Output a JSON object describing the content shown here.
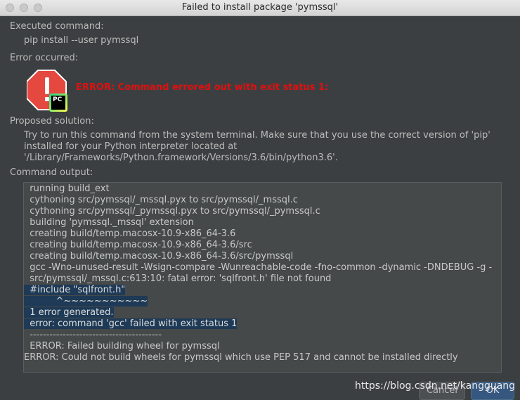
{
  "window": {
    "title": "Failed to install package 'pymssql'"
  },
  "executed": {
    "label": "Executed command:",
    "command": "pip install --user pymssql"
  },
  "error": {
    "label": "Error occurred:",
    "message": "ERROR: Command errored out with exit status 1:",
    "icon": "error-stop-icon",
    "badge": "PC"
  },
  "solution": {
    "label": "Proposed solution:",
    "lines": [
      "Try to run this command from the system terminal. Make sure that you use the correct version of 'pip'",
      "installed for your Python interpreter located at",
      "'/Library/Frameworks/Python.framework/Versions/3.6/bin/python3.6'."
    ]
  },
  "output": {
    "label": "Command output:",
    "lines": [
      "  running build_ext",
      "  cythoning src/pymssql/_mssql.pyx to src/pymssql/_mssql.c",
      "  cythoning src/pymssql/_pymssql.pyx to src/pymssql/_pymssql.c",
      "  building 'pymssql._mssql' extension",
      "  creating build/temp.macosx-10.9-x86_64-3.6",
      "  creating build/temp.macosx-10.9-x86_64-3.6/src",
      "  creating build/temp.macosx-10.9-x86_64-3.6/src/pymssql",
      "  gcc -Wno-unused-result -Wsign-compare -Wunreachable-code -fno-common -dynamic -DNDEBUG -g -",
      "  src/pymssql/_mssql.c:613:10: fatal error: 'sqlfront.h' file not found",
      "  #include \"sqlfront.h\"",
      "           ^~~~~~~~~~~~",
      "  1 error generated.",
      "  error: command 'gcc' failed with exit status 1",
      "  ----------------------------------------",
      "  ERROR: Failed building wheel for pymssql",
      "ERROR: Could not build wheels for pymssql which use PEP 517 and cannot be installed directly"
    ]
  },
  "buttons": {
    "cancel": "Cancel",
    "ok": "OK"
  },
  "watermark": "https://blog.csdn.net/kangguang",
  "colors": {
    "background": "#3c3f41",
    "error_red": "#e01010",
    "selection": "#1e3a56",
    "ok_button": "#365880"
  }
}
